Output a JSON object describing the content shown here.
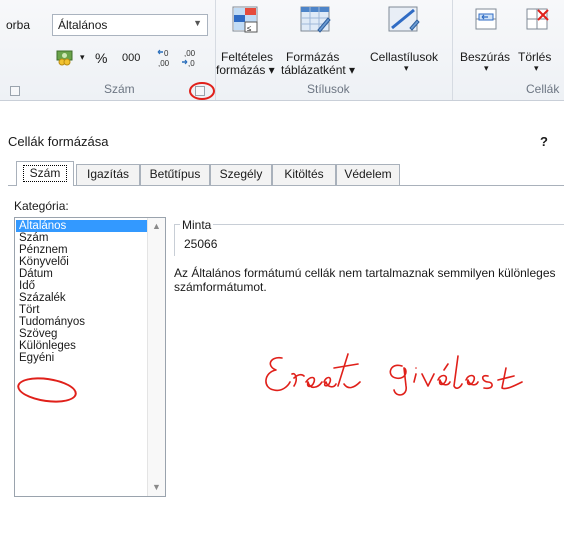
{
  "ribbon": {
    "partial_label": "orba",
    "number_format": "Általános",
    "percent_symbol": "%",
    "thousands_symbol": "000",
    "group_number": "Szám",
    "group_styles": "Stílusok",
    "group_cells": "Cellák",
    "conditional_line1": "Feltételes",
    "conditional_line2": "formázás ▾",
    "format_table_line1": "Formázás",
    "format_table_line2": "táblázatként ▾",
    "cell_styles": "Cellastílusok",
    "insert": "Beszúrás",
    "delete": "Törlés",
    "dropdown_arrow": "▾",
    "annotation_color": "#e0201a"
  },
  "dialog": {
    "title": "Cellák formázása",
    "help": "?",
    "tabs": [
      "Szám",
      "Igazítás",
      "Betűtípus",
      "Szegély",
      "Kitöltés",
      "Védelem"
    ],
    "category_label": "Kategória:",
    "categories": [
      "Általános",
      "Szám",
      "Pénznem",
      "Könyvelői",
      "Dátum",
      "Idő",
      "Százalék",
      "Tört",
      "Tudományos",
      "Szöveg",
      "Különleges",
      "Egyéni"
    ],
    "selected_category": "Általános",
    "sample_label": "Minta",
    "sample_value": "25066",
    "description": "Az Általános formátumú cellák nem tartalmaznak semmilyen különleges számformátumot.",
    "selection_color": "#3399ff"
  }
}
